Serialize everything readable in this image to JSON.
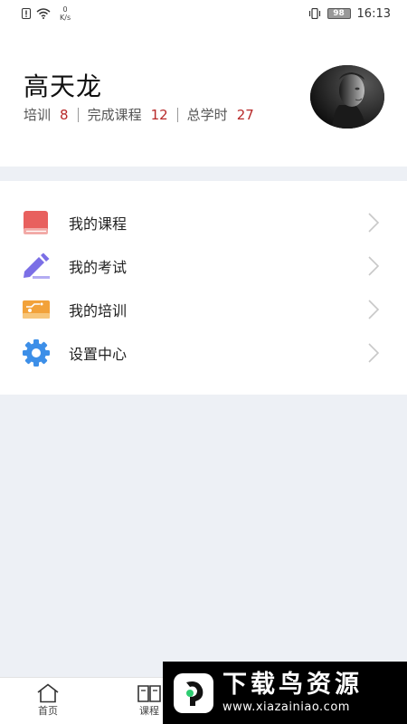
{
  "status_bar": {
    "net_speed_value": "0",
    "net_speed_unit": "K/s",
    "battery": "98",
    "time": "16:13"
  },
  "profile": {
    "name": "高天龙",
    "stats": [
      {
        "label": "培训",
        "value": "8"
      },
      {
        "label": "完成课程",
        "value": "12"
      },
      {
        "label": "总学时",
        "value": "27"
      }
    ]
  },
  "menu": {
    "items": [
      {
        "label": "我的课程",
        "icon": "book-icon"
      },
      {
        "label": "我的考试",
        "icon": "pencil-icon"
      },
      {
        "label": "我的培训",
        "icon": "training-icon"
      },
      {
        "label": "设置中心",
        "icon": "gear-icon"
      }
    ]
  },
  "bottom_nav": {
    "items": [
      {
        "label": "首页",
        "icon": "home-icon"
      },
      {
        "label": "课程",
        "icon": "book-open-icon"
      }
    ]
  },
  "watermark": {
    "title": "下载鸟资源",
    "url": "www.xiazainiao.com"
  },
  "colors": {
    "accent_value": "#b82a2a",
    "background": "#edf0f5",
    "book_icon": "#e8605e",
    "pencil_icon": "#7b6fe6",
    "training_icon": "#f2a23a",
    "gear_icon": "#3d8fe8"
  }
}
